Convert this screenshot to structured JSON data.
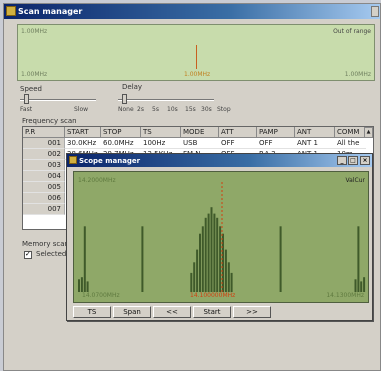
{
  "scan_window": {
    "title": "Scan manager",
    "top_spectrum": {
      "left_top_label": "1.00MHz",
      "right_top_label": "Out of range",
      "left_bottom_label": "1.00MHz",
      "center_label": "1.00MHz",
      "right_bottom_label": "1.00MHz"
    },
    "speed": {
      "label": "Speed",
      "min_label": "Fast",
      "max_label": "Slow"
    },
    "delay": {
      "label": "Delay",
      "ticks": [
        "None",
        "2s",
        "5s",
        "10s",
        "15s",
        "30s",
        "Stop"
      ]
    },
    "frequency_scan": {
      "label": "Frequency scan",
      "columns": [
        "P.R",
        "START",
        "STOP",
        "TS",
        "MODE",
        "ATT",
        "PAMP",
        "ANT",
        "COMM"
      ],
      "rows": [
        [
          "001",
          "30.0KHz",
          "60.0MHz",
          "100Hz",
          "USB",
          "OFF",
          "OFF",
          "ANT 1",
          "All the"
        ],
        [
          "002",
          "28.6MHz",
          "29.7MHz",
          "12.5KHz",
          "FM N",
          "OFF",
          "P.A.2",
          "ANT 1",
          "10m"
        ],
        [
          "003",
          "",
          "",
          "",
          "",
          "",
          "",
          "",
          ""
        ],
        [
          "004",
          "",
          "",
          "",
          "",
          "",
          "",
          "",
          ""
        ],
        [
          "005",
          "",
          "",
          "",
          "",
          "",
          "",
          "",
          ""
        ],
        [
          "006",
          "",
          "",
          "",
          "",
          "",
          "",
          "",
          ""
        ],
        [
          "007",
          "",
          "",
          "",
          "",
          "",
          "",
          "",
          ""
        ]
      ]
    },
    "memory_scan": {
      "label": "Memory scan",
      "selected_checkbox_label": "Selected ch",
      "selected_checked": true
    }
  },
  "scope_window": {
    "title": "Scope manager",
    "buttons": {
      "minimize": "_",
      "restore": "□",
      "close": "×"
    },
    "spectrum": {
      "top_left_label": "14.2000MHz",
      "top_right_label": "ValCur",
      "bottom_left_label": "14.0700MHz",
      "bottom_center_label": "14.100000MHz",
      "bottom_right_label": "14.1300MHz"
    },
    "toolbar": {
      "ts_label": "TS",
      "span_label": "Span",
      "prev_label": "<<",
      "start_label": "Start",
      "next_label": ">>"
    },
    "bar_levels": [
      0.12,
      0.14,
      0.62,
      0.1,
      0.0,
      0.0,
      0.0,
      0.0,
      0.0,
      0.0,
      0.0,
      0.0,
      0.0,
      0.0,
      0.0,
      0.0,
      0.0,
      0.0,
      0.0,
      0.0,
      0.0,
      0.0,
      0.62,
      0.0,
      0.0,
      0.0,
      0.0,
      0.0,
      0.0,
      0.0,
      0.0,
      0.0,
      0.0,
      0.0,
      0.0,
      0.0,
      0.0,
      0.0,
      0.0,
      0.18,
      0.28,
      0.4,
      0.55,
      0.62,
      0.7,
      0.74,
      0.8,
      0.74,
      0.7,
      0.62,
      0.55,
      0.4,
      0.28,
      0.18,
      0.0,
      0.0,
      0.0,
      0.0,
      0.0,
      0.0,
      0.0,
      0.0,
      0.0,
      0.0,
      0.0,
      0.0,
      0.0,
      0.0,
      0.0,
      0.0,
      0.62,
      0.0,
      0.0,
      0.0,
      0.0,
      0.0,
      0.0,
      0.0,
      0.0,
      0.0,
      0.0,
      0.0,
      0.0,
      0.0,
      0.0,
      0.0,
      0.0,
      0.0,
      0.0,
      0.0,
      0.0,
      0.0,
      0.0,
      0.0,
      0.0,
      0.0,
      0.12,
      0.62,
      0.1,
      0.14
    ],
    "bar_color": "#3f5a2a",
    "center_marker_color": "#d04010"
  }
}
